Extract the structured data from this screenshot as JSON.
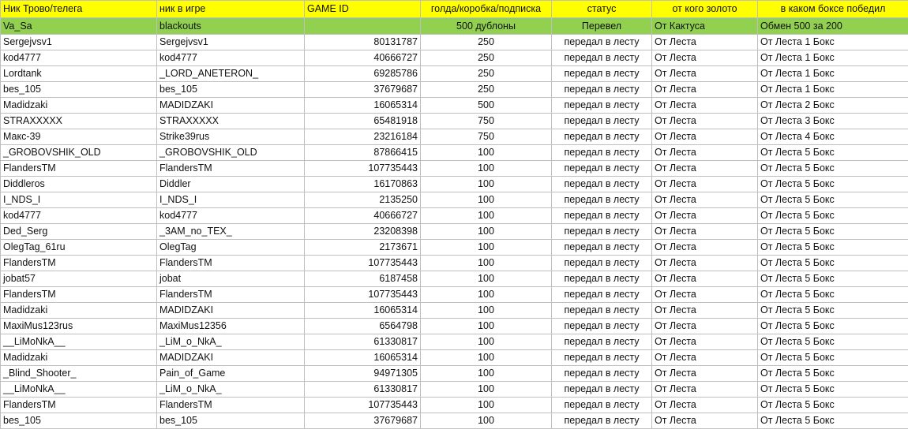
{
  "colors": {
    "header_fill": "#ffff00",
    "subheader_fill": "#92d050",
    "grid_line": "#bfbfbf"
  },
  "columns": [
    "Ник Трово/телега",
    "ник в игре",
    "GAME ID",
    "голда/коробка/подписка",
    "статус",
    "от кого золото",
    "в каком боксе победил"
  ],
  "subheader": [
    "Va_Sa",
    "blackouts",
    "",
    "500 дублоны",
    "Перевел",
    "От Кактуса",
    "Обмен 500 за 200"
  ],
  "rows": [
    [
      "Sergejvsv1",
      "Sergejvsv1",
      "80131787",
      "250",
      "передал в лесту",
      "От Леста",
      "От Леста 1 Бокс"
    ],
    [
      "kod4777",
      "kod4777",
      "40666727",
      "250",
      "передал в лесту",
      "От Леста",
      "От Леста 1 Бокс"
    ],
    [
      "Lordtank",
      "_LORD_ANETERON_",
      "69285786",
      "250",
      "передал в лесту",
      "От Леста",
      "От Леста 1 Бокс"
    ],
    [
      "bes_105",
      "bes_105",
      "37679687",
      "250",
      "передал в лесту",
      "От Леста",
      "От Леста 1 Бокс"
    ],
    [
      "Madidzaki",
      "MADIDZAKI",
      "16065314",
      "500",
      "передал в лесту",
      "От Леста",
      "От Леста 2 Бокс"
    ],
    [
      "STRAXXXXX",
      "STRAXXXXX",
      "65481918",
      "750",
      "передал в лесту",
      "От Леста",
      "От Леста 3 Бокс"
    ],
    [
      "Макс-39",
      "Strike39rus",
      "23216184",
      "750",
      "передал в лесту",
      "От Леста",
      "От Леста 4 Бокс"
    ],
    [
      "_GROBOVSHIK_OLD",
      "_GROBOVSHIK_OLD",
      "87866415",
      "100",
      "передал в лесту",
      "От Леста",
      "От Леста 5 Бокс"
    ],
    [
      "FlandersTM",
      "FlandersTM",
      "107735443",
      "100",
      "передал в лесту",
      "От Леста",
      "От Леста 5 Бокс"
    ],
    [
      "Diddleros",
      "Diddler",
      "16170863",
      "100",
      "передал в лесту",
      "От Леста",
      "От Леста 5 Бокс"
    ],
    [
      "I_NDS_I",
      "I_NDS_I",
      "2135250",
      "100",
      "передал в лесту",
      "От Леста",
      "От Леста 5 Бокс"
    ],
    [
      "kod4777",
      "kod4777",
      "40666727",
      "100",
      "передал в лесту",
      "От Леста",
      "От Леста 5 Бокс"
    ],
    [
      "Ded_Serg",
      "_3AM_no_TEX_",
      "23208398",
      "100",
      "передал в лесту",
      "От Леста",
      "От Леста 5 Бокс"
    ],
    [
      "OlegTag_61ru",
      "OlegTag",
      "2173671",
      "100",
      "передал в лесту",
      "От Леста",
      "От Леста 5 Бокс"
    ],
    [
      "FlandersTM",
      "FlandersTM",
      "107735443",
      "100",
      "передал в лесту",
      "От Леста",
      "От Леста 5 Бокс"
    ],
    [
      "jobat57",
      "jobat",
      "6187458",
      "100",
      "передал в лесту",
      "От Леста",
      "От Леста 5 Бокс"
    ],
    [
      "FlandersTM",
      "FlandersTM",
      "107735443",
      "100",
      "передал в лесту",
      "От Леста",
      "От Леста 5 Бокс"
    ],
    [
      "Madidzaki",
      "MADIDZAKI",
      "16065314",
      "100",
      "передал в лесту",
      "От Леста",
      "От Леста 5 Бокс"
    ],
    [
      "MaxiMus123rus",
      "MaxiMus12356",
      "6564798",
      "100",
      "передал в лесту",
      "От Леста",
      "От Леста 5 Бокс"
    ],
    [
      "__LiMoNkA__",
      "_LiM_o_NkA_",
      "61330817",
      "100",
      "передал в лесту",
      "От Леста",
      "От Леста 5 Бокс"
    ],
    [
      "Madidzaki",
      "MADIDZAKI",
      "16065314",
      "100",
      "передал в лесту",
      "От Леста",
      "От Леста 5 Бокс"
    ],
    [
      "_Blind_Shooter_",
      "Pain_of_Game",
      "94971305",
      "100",
      "передал в лесту",
      "От Леста",
      "От Леста 5 Бокс"
    ],
    [
      "__LiMoNkA__",
      "_LiM_o_NkA_",
      "61330817",
      "100",
      "передал в лесту",
      "От Леста",
      "От Леста 5 Бокс"
    ],
    [
      "FlandersTM",
      "FlandersTM",
      "107735443",
      "100",
      "передал в лесту",
      "От Леста",
      "От Леста 5 Бокс"
    ],
    [
      "bes_105",
      "bes_105",
      "37679687",
      "100",
      "передал в лесту",
      "От Леста",
      "От Леста 5 Бокс"
    ]
  ]
}
